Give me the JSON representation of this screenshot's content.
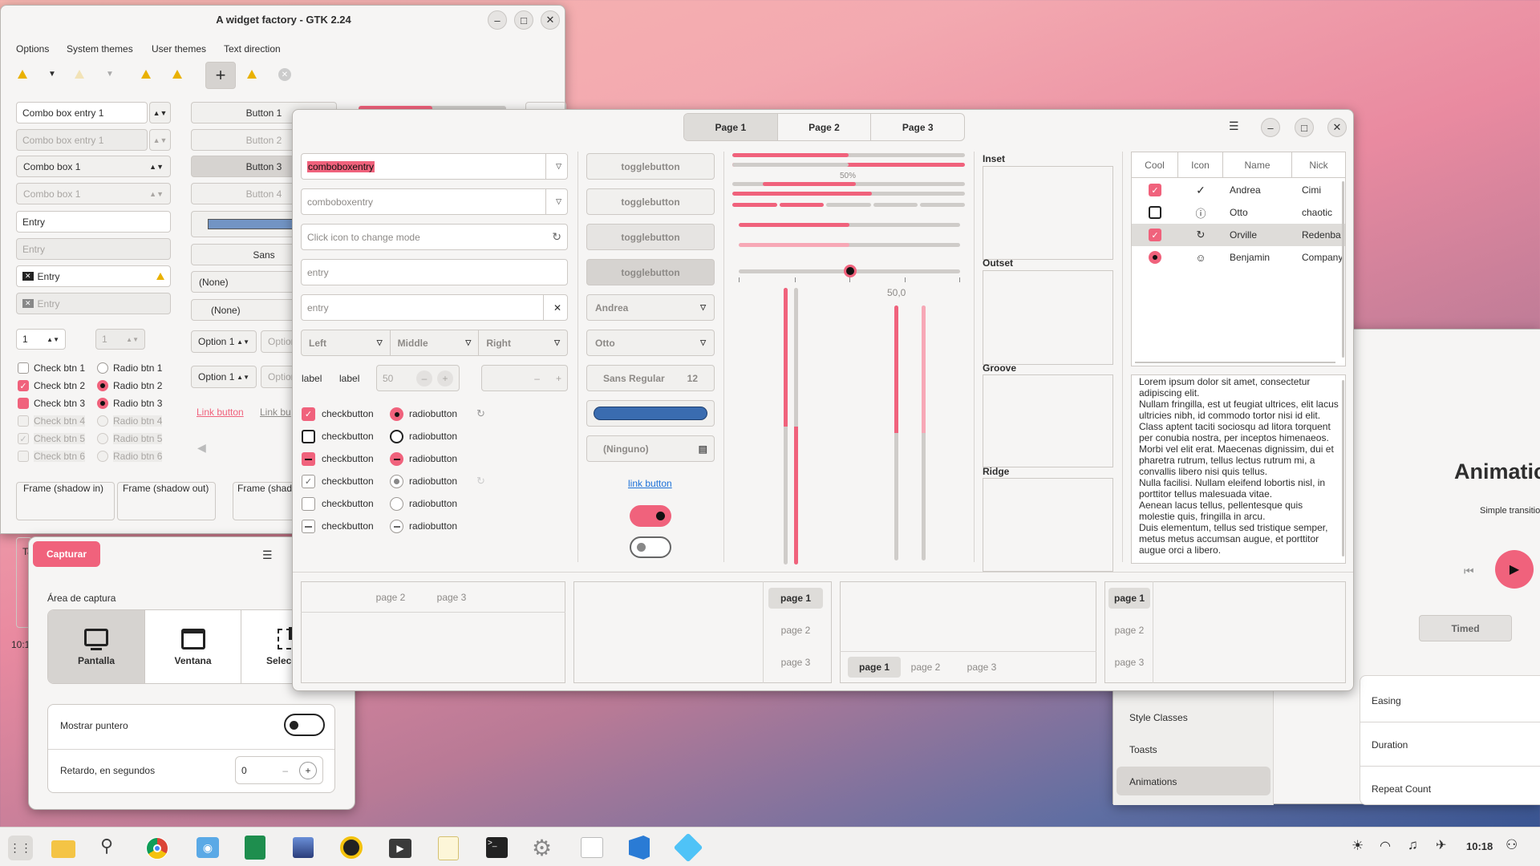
{
  "colors": {
    "accent": "#f0627c",
    "window": "#f6f5f4",
    "blue_bar": "#3a6cb0"
  },
  "widget_factory_back": {
    "title": "A widget factory - GTK 2.24",
    "menu": [
      "Options",
      "System themes",
      "User themes",
      "Text direction"
    ],
    "combo_entry_1": "Combo box entry 1",
    "combo_entry_1_dis": "Combo box entry 1",
    "combo_1": "Combo box 1",
    "combo_1_dis": "Combo box 1",
    "entry": "Entry",
    "entry_dis": "Entry",
    "entry_icon": "Entry",
    "entry_icon_dis": "Entry",
    "spin_1": "1",
    "spin_1_dis": "1",
    "checks": [
      "Check btn 1",
      "Check btn 2",
      "Check btn 3",
      "Check btn 4",
      "Check btn 5",
      "Check btn 6"
    ],
    "radios": [
      "Radio btn 1",
      "Radio btn 2",
      "Radio btn 3",
      "Radio btn 4",
      "Radio btn 5",
      "Radio btn 6"
    ],
    "buttons": [
      "Button 1",
      "Button 2",
      "Button 3",
      "Button 4"
    ],
    "font_btn": "Sans",
    "none_1": "(None)",
    "none_2": "(None)",
    "option_1": "Option 1",
    "option_1b": "Option 1",
    "option_ghost": "Option",
    "option_ghost_b": "Option",
    "link_button": "Link button",
    "link_button_2": "Link bu",
    "frames": [
      "Frame (shadow in)",
      "Frame (shadow out)",
      "Frame (shad"
    ],
    "clock_fragment": "10:1",
    "tab_fragment": "Ta"
  },
  "widget_factory_front": {
    "tabs": [
      "Page 1",
      "Page 2",
      "Page 3"
    ],
    "combo_entry_sel": "comboboxentry",
    "combo_entry_ph": "comboboxentry",
    "mode_entry_ph": "Click icon to change mode",
    "entry_ph": "entry",
    "entry_ph_2": "entry",
    "segments": [
      "Left",
      "Middle",
      "Right"
    ],
    "label_1": "label",
    "label_2": "label",
    "spin_50": "50",
    "checkbuttons": [
      "checkbutton",
      "checkbutton",
      "checkbutton",
      "checkbutton",
      "checkbutton",
      "checkbutton"
    ],
    "radiobuttons": [
      "radiobutton",
      "radiobutton",
      "radiobutton",
      "radiobutton",
      "radiobutton",
      "radiobutton"
    ],
    "togglebuttons": [
      "togglebutton",
      "togglebutton",
      "togglebutton",
      "togglebutton"
    ],
    "combo_andrea": "Andrea",
    "combo_otto": "Otto",
    "font_name": "Sans Regular",
    "font_size": "12",
    "file_none": "(Ninguno)",
    "link_button": "link button",
    "progress_label": "50%",
    "scale_value": "50,0",
    "progress_1": 0.5,
    "progress_2": 0.5,
    "progress_3": 0.6,
    "scale_pos": 0.5,
    "frames": [
      "Inset",
      "Outset",
      "Groove",
      "Ridge"
    ],
    "tree_headers": [
      "Cool",
      "Icon",
      "Name",
      "Nick"
    ],
    "tree_rows": [
      {
        "name": "Andrea",
        "nick": "Cimi",
        "icon": "check-circle-icon",
        "cool": "checked"
      },
      {
        "name": "Otto",
        "nick": "chaotic",
        "icon": "alert-circle-icon",
        "cool": "unchecked"
      },
      {
        "name": "Orville",
        "nick": "Redenba…",
        "icon": "refresh-icon",
        "cool": "checked"
      },
      {
        "name": "Benjamin",
        "nick": "Company",
        "icon": "face-icon",
        "cool": "radio"
      }
    ],
    "lorem": "Lorem ipsum dolor sit amet, consectetur adipiscing elit.\nNullam fringilla, est ut feugiat ultrices, elit lacus ultricies nibh, id commodo tortor nisi id elit.\nClass aptent taciti sociosqu ad litora torquent per conubia nostra, per inceptos himenaeos.\nMorbi vel elit erat. Maecenas dignissim, dui et pharetra rutrum, tellus lectus rutrum mi, a convallis libero nisi quis tellus.\nNulla facilisi. Nullam eleifend lobortis nisl, in porttitor tellus malesuada vitae.\nAenean lacus tellus, pellentesque quis molestie quis, fringilla in arcu.\nDuis elementum, tellus sed tristique semper, metus metus accumsan augue, et porttitor augue orci a libero.",
    "nb_tabs": [
      "page 1",
      "page 2",
      "page 3"
    ]
  },
  "capture": {
    "capture_btn": "Capturar",
    "area_label": "Área de captura",
    "modes": [
      "Pantalla",
      "Ventana",
      "Selección"
    ],
    "show_pointer": "Mostrar puntero",
    "delay": "Retardo, en segundos",
    "delay_value": "0"
  },
  "demo": {
    "title": "Animatic",
    "subtitle": "Simple transitio",
    "timed": "Timed",
    "sidebar": [
      "Style Classes",
      "Toasts",
      "Animations"
    ],
    "props": [
      "Easing",
      "Duration",
      "Repeat Count"
    ]
  },
  "panel": {
    "clock": "10:18"
  }
}
